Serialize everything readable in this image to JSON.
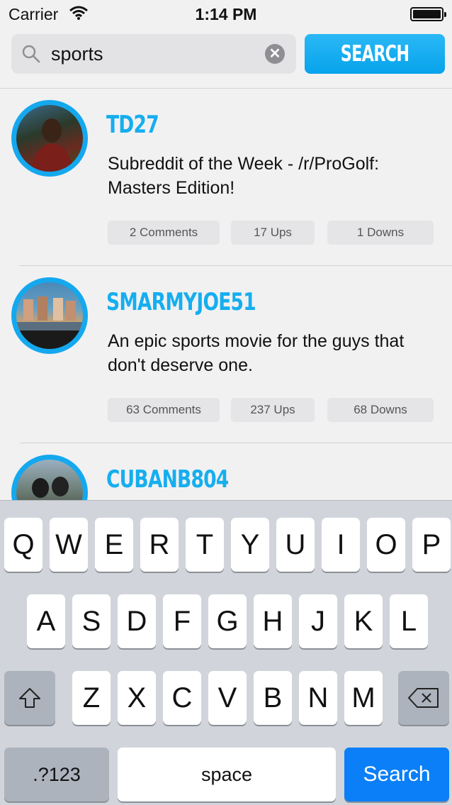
{
  "status_bar": {
    "carrier": "Carrier",
    "time": "1:14 PM"
  },
  "search": {
    "query": "sports",
    "button_label": "SEARCH"
  },
  "posts": [
    {
      "username": "TD27",
      "text": "Subreddit of the Week - /r/ProGolf: Masters Edition!",
      "comments": "2 Comments",
      "ups": "17 Ups",
      "downs": "1 Downs"
    },
    {
      "username": "SMARMYJOE51",
      "text": "An epic sports movie for the guys that don't deserve one.",
      "comments": "63 Comments",
      "ups": "237 Ups",
      "downs": "68 Downs"
    },
    {
      "username": "CUBANB804"
    }
  ],
  "keyboard": {
    "row1": [
      "Q",
      "W",
      "E",
      "R",
      "T",
      "Y",
      "U",
      "I",
      "O",
      "P"
    ],
    "row2": [
      "A",
      "S",
      "D",
      "F",
      "G",
      "H",
      "J",
      "K",
      "L"
    ],
    "row3": [
      "Z",
      "X",
      "C",
      "V",
      "B",
      "N",
      "M"
    ],
    "numbers_label": ".?123",
    "space_label": "space",
    "go_label": "Search"
  },
  "colors": {
    "accent": "#15aeef",
    "go_key": "#0a7ff8"
  }
}
